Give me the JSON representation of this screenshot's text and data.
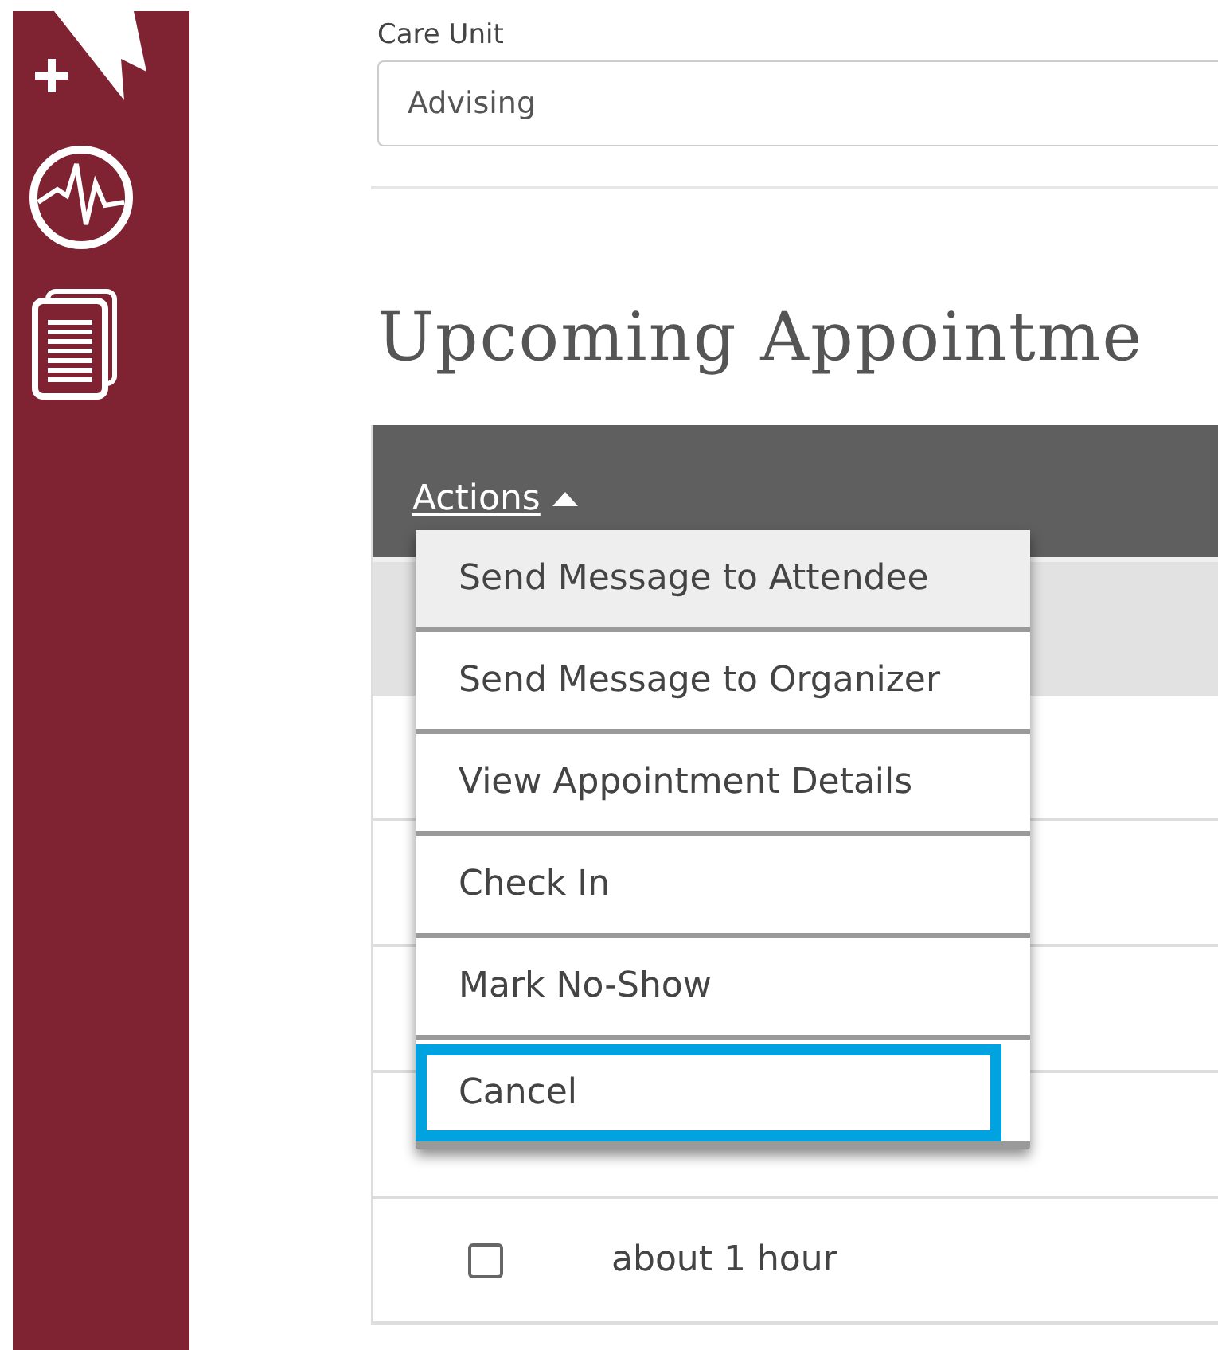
{
  "care_unit": {
    "label": "Care Unit",
    "value": "Advising"
  },
  "section_title": "Upcoming Appointme",
  "table": {
    "header_action": "Actions",
    "menu_open": true,
    "rows": [
      {
        "checked": false,
        "time": "about 1 hour"
      }
    ]
  },
  "actions_menu": [
    {
      "label": "Send Message to Attendee",
      "hovered": true,
      "focused": false
    },
    {
      "label": "Send Message to Organizer",
      "hovered": false,
      "focused": false
    },
    {
      "label": "View Appointment Details",
      "hovered": false,
      "focused": false
    },
    {
      "label": "Check In",
      "hovered": false,
      "focused": false
    },
    {
      "label": "Mark No-Show",
      "hovered": false,
      "focused": false
    },
    {
      "label": "Cancel",
      "hovered": false,
      "focused": true
    }
  ]
}
